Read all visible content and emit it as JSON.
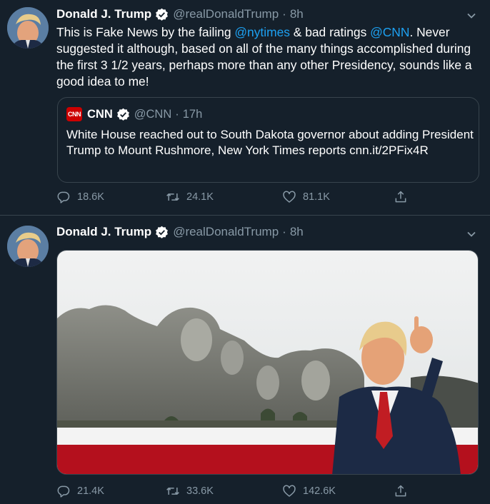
{
  "colors": {
    "background": "#15202b",
    "accent": "#1da1f2",
    "muted": "#8899a6",
    "border": "#38444d",
    "verified": "#ffffff"
  },
  "tweets": [
    {
      "author": {
        "name": "Donald J. Trump",
        "handle": "@realDonaldTrump",
        "verified": true
      },
      "time": "8h",
      "separator": "·",
      "text": {
        "p1": "This is Fake News by the failing ",
        "m1": "@nytimes",
        "p2": " & bad ratings ",
        "m2": "@CNN",
        "p3": ". Never suggested it although, based on all of the many things accomplished during the first 3 1/2 years, perhaps more than any other Presidency, sounds like a good idea to me!"
      },
      "quote": {
        "logo_text": "CNN",
        "name": "CNN",
        "handle": "@CNN",
        "separator": "·",
        "time": "17h",
        "text": "White House reached out to South Dakota governor about adding President Trump to Mount Rushmore, New York Times reports cnn.it/2PFix4R"
      },
      "actions": {
        "replies": "18.6K",
        "retweets": "24.1K",
        "likes": "81.1K"
      }
    },
    {
      "author": {
        "name": "Donald J. Trump",
        "handle": "@realDonaldTrump",
        "verified": true
      },
      "time": "8h",
      "separator": "·",
      "media": {
        "icon": "photo-mount-rushmore"
      },
      "actions": {
        "replies": "21.4K",
        "retweets": "33.6K",
        "likes": "142.6K"
      }
    }
  ],
  "icons": [
    "verified-badge-icon",
    "chevron-down-icon",
    "reply-icon",
    "retweet-icon",
    "like-icon",
    "share-icon"
  ]
}
